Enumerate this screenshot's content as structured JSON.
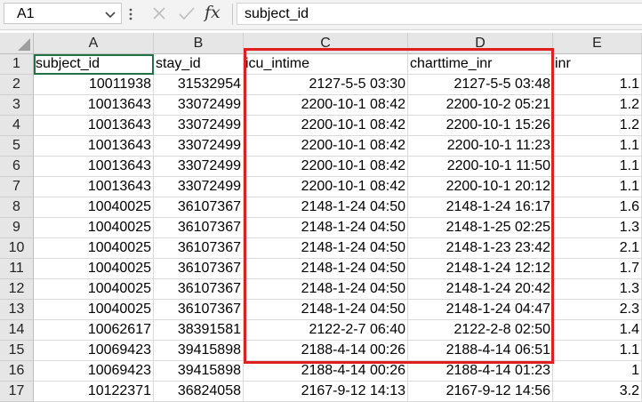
{
  "name_box": {
    "value": "A1"
  },
  "formula_bar": {
    "cancel_icon": "close-icon",
    "enter_icon": "check-icon",
    "fx_label": "fx",
    "value": "subject_id"
  },
  "colors": {
    "highlight": "#e02020",
    "header_bg": "#e6e6e6",
    "grid_line": "#dadada"
  },
  "columns": [
    "A",
    "B",
    "C",
    "D",
    "E"
  ],
  "rows": [
    {
      "num": "1",
      "cells": [
        "subject_id",
        "stay_id",
        "icu_intime",
        "charttime_inr",
        "inr"
      ]
    },
    {
      "num": "2",
      "cells": [
        "10011938",
        "31532954",
        "2127-5-5 03:30",
        "2127-5-5 03:48",
        "1.1"
      ]
    },
    {
      "num": "3",
      "cells": [
        "10013643",
        "33072499",
        "2200-10-1 08:42",
        "2200-10-2 05:21",
        "1.2"
      ]
    },
    {
      "num": "4",
      "cells": [
        "10013643",
        "33072499",
        "2200-10-1 08:42",
        "2200-10-1 15:26",
        "1.2"
      ]
    },
    {
      "num": "5",
      "cells": [
        "10013643",
        "33072499",
        "2200-10-1 08:42",
        "2200-10-1 11:23",
        "1.1"
      ]
    },
    {
      "num": "6",
      "cells": [
        "10013643",
        "33072499",
        "2200-10-1 08:42",
        "2200-10-1 11:50",
        "1.1"
      ]
    },
    {
      "num": "7",
      "cells": [
        "10013643",
        "33072499",
        "2200-10-1 08:42",
        "2200-10-1 20:12",
        "1.1"
      ]
    },
    {
      "num": "8",
      "cells": [
        "10040025",
        "36107367",
        "2148-1-24 04:50",
        "2148-1-24 16:17",
        "1.6"
      ]
    },
    {
      "num": "9",
      "cells": [
        "10040025",
        "36107367",
        "2148-1-24 04:50",
        "2148-1-25 02:25",
        "1.3"
      ]
    },
    {
      "num": "10",
      "cells": [
        "10040025",
        "36107367",
        "2148-1-24 04:50",
        "2148-1-23 23:42",
        "2.1"
      ]
    },
    {
      "num": "11",
      "cells": [
        "10040025",
        "36107367",
        "2148-1-24 04:50",
        "2148-1-24 12:12",
        "1.7"
      ]
    },
    {
      "num": "12",
      "cells": [
        "10040025",
        "36107367",
        "2148-1-24 04:50",
        "2148-1-24 20:42",
        "1.3"
      ]
    },
    {
      "num": "13",
      "cells": [
        "10040025",
        "36107367",
        "2148-1-24 04:50",
        "2148-1-24 04:47",
        "2.3"
      ]
    },
    {
      "num": "14",
      "cells": [
        "10062617",
        "38391581",
        "2122-2-7 06:40",
        "2122-2-8 02:50",
        "1.4"
      ]
    },
    {
      "num": "15",
      "cells": [
        "10069423",
        "39415898",
        "2188-4-14 00:26",
        "2188-4-14 06:51",
        "1.1"
      ]
    },
    {
      "num": "16",
      "cells": [
        "10069423",
        "39415898",
        "2188-4-14 00:26",
        "2188-4-14 01:23",
        "1"
      ]
    },
    {
      "num": "17",
      "cells": [
        "10122371",
        "36824058",
        "2167-9-12 14:13",
        "2167-9-12 14:56",
        "3.2"
      ]
    }
  ]
}
